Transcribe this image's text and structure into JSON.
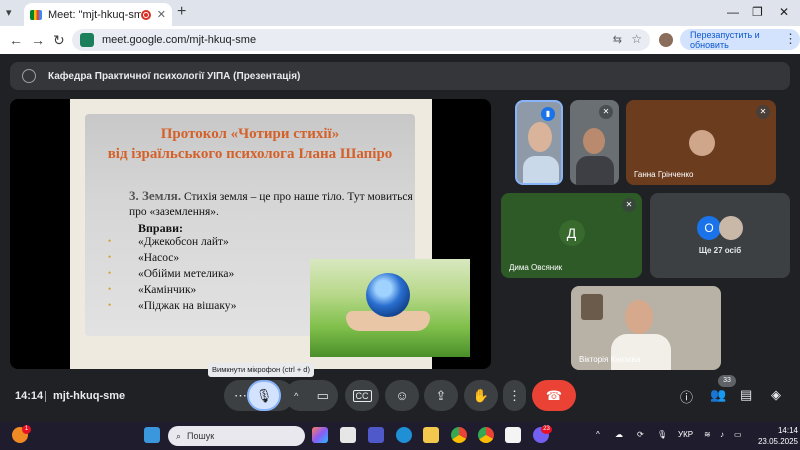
{
  "browser": {
    "tab_title": "Meet: \"mjt-hkuq-sme\"",
    "url": "meet.google.com/mjt-hkuq-sme",
    "relaunch_label": "Перезапустить и обновить"
  },
  "meet": {
    "presentation_banner": "Кафедра Практичної психології УІПА (Презентація)",
    "slide": {
      "title_line1": "Протокол «Чотири стихії»",
      "title_line2": "від ізраїльського психолога Ілана Шапіро",
      "lead": "3. Земля.",
      "body": "Стихія земля – це про наше тіло. Тут мовиться про «заземлення».",
      "exercises_heading": "Вправи:",
      "exercises": [
        "«Джекобсон лайт»",
        "«Насос»",
        "«Обійми метелика»",
        "«Камінчик»",
        "«Піджак на вішаку»"
      ]
    },
    "participants": {
      "hanna": "Ганна Грінченко",
      "dyma_initial": "Д",
      "dyma": "Дима Овсяник",
      "more_initial": "О",
      "more": "Ще 27 осіб",
      "viktoria": "Вікторія Князєва"
    },
    "controls": {
      "time": "14:14",
      "meeting_code": "mjt-hkuq-sme",
      "mic_tooltip": "Вимкнути мікрофон (ctrl + d)",
      "people_count": "33"
    }
  },
  "taskbar": {
    "search_placeholder": "Пошук",
    "weather_badge": "1",
    "app_badge": "23",
    "language": "УКР",
    "clock_time": "14:14",
    "clock_date": "23.05.2025"
  }
}
